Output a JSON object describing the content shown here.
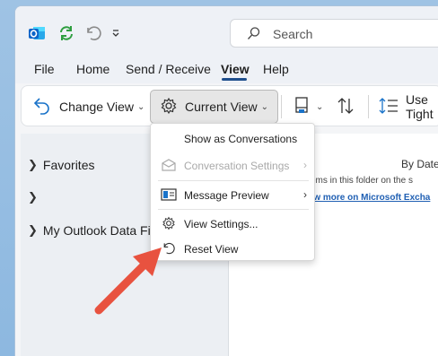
{
  "search": {
    "placeholder": "Search"
  },
  "menu_tabs": [
    {
      "label": "File"
    },
    {
      "label": "Home"
    },
    {
      "label": "Send / Receive"
    },
    {
      "label": "View"
    },
    {
      "label": "Help"
    }
  ],
  "ribbon": {
    "change_view": "Change View",
    "current_view": "Current View",
    "use_tight": "Use Tight"
  },
  "folders": {
    "favorites": "Favorites",
    "unnamed_dot": ":",
    "outlook_data_file": "My Outlook Data Fil"
  },
  "content": {
    "sort_label": "By Date",
    "info_text": "items in this folder on the s",
    "info_link": "iew more on Microsoft Excha"
  },
  "dropdown": {
    "items": [
      {
        "label": "Show as Conversations",
        "enabled": true
      },
      {
        "label": "Conversation Settings",
        "enabled": false,
        "submenu": true
      },
      {
        "label": "Message Preview",
        "enabled": true,
        "submenu": true
      },
      {
        "label": "View Settings...",
        "enabled": true
      },
      {
        "label": "Reset View",
        "enabled": true
      }
    ]
  },
  "colors": {
    "accent": "#1e4e8c",
    "annotation_arrow": "#e8523f",
    "link": "#1f5fb3"
  },
  "icons": {
    "app": "outlook-icon",
    "sync": "sync-icon",
    "undo": "undo-icon",
    "customize": "chevron-down-icon",
    "search": "search-icon"
  }
}
